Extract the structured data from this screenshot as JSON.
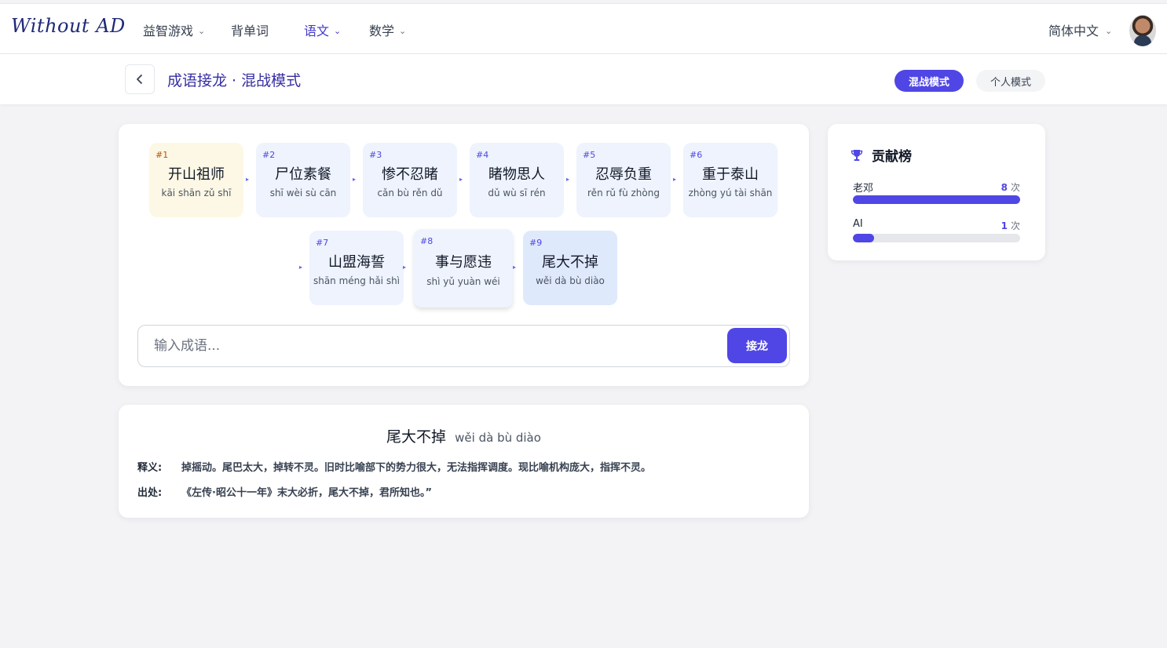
{
  "nav": {
    "logo": "Without AD",
    "items": [
      {
        "label": "益智游戏",
        "has_menu": true,
        "active": false
      },
      {
        "label": "背单词",
        "has_menu": false,
        "active": false
      },
      {
        "label": "语文",
        "has_menu": true,
        "active": true
      },
      {
        "label": "数学",
        "has_menu": true,
        "active": false
      }
    ],
    "language": "简体中文"
  },
  "header": {
    "title": "成语接龙 · 混战模式",
    "mode_buttons": [
      {
        "label": "混战模式",
        "selected": true
      },
      {
        "label": "个人模式",
        "selected": false
      }
    ]
  },
  "chain": [
    {
      "num": "#1",
      "word": "开山祖师",
      "pinyin": "kāi shān zǔ shī"
    },
    {
      "num": "#2",
      "word": "尸位素餐",
      "pinyin": "shī wèi sù cān"
    },
    {
      "num": "#3",
      "word": "惨不忍睹",
      "pinyin": "cǎn bù rěn dǔ"
    },
    {
      "num": "#4",
      "word": "睹物思人",
      "pinyin": "dǔ wù sī rén"
    },
    {
      "num": "#5",
      "word": "忍辱负重",
      "pinyin": "rěn rǔ fù zhòng"
    },
    {
      "num": "#6",
      "word": "重于泰山",
      "pinyin": "zhòng yú tài shān"
    },
    {
      "num": "#7",
      "word": "山盟海誓",
      "pinyin": "shān méng hǎi shì"
    },
    {
      "num": "#8",
      "word": "事与愿违",
      "pinyin": "shì yǔ yuàn wéi"
    },
    {
      "num": "#9",
      "word": "尾大不掉",
      "pinyin": "wěi dà bù diào"
    }
  ],
  "input": {
    "placeholder": "输入成语...",
    "value": "",
    "submit_label": "接龙"
  },
  "detail": {
    "word": "尾大不掉",
    "pinyin": "wěi dà bù diào",
    "meaning_label": "释义:",
    "meaning": "掉摇动。尾巴太大，掉转不灵。旧时比喻部下的势力很大，无法指挥调度。现比喻机构庞大，指挥不灵。",
    "source_label": "出处:",
    "source": "《左传·昭公十一年》末大必折，尾大不掉，君所知也。”"
  },
  "leaderboard": {
    "title": "贡献榜",
    "unit": "次",
    "entries": [
      {
        "name": "老邓",
        "count": "8",
        "share": 1.0
      },
      {
        "name": "AI",
        "count": "1",
        "share": 0.125
      }
    ]
  },
  "colors": {
    "accent": "#4f46e5",
    "first_tile": "#fdf8e5",
    "tile": "#eef3fd"
  },
  "icons": {
    "back": "chevron-left-icon",
    "trophy": "trophy-icon",
    "menu": "chevron-down-icon"
  }
}
